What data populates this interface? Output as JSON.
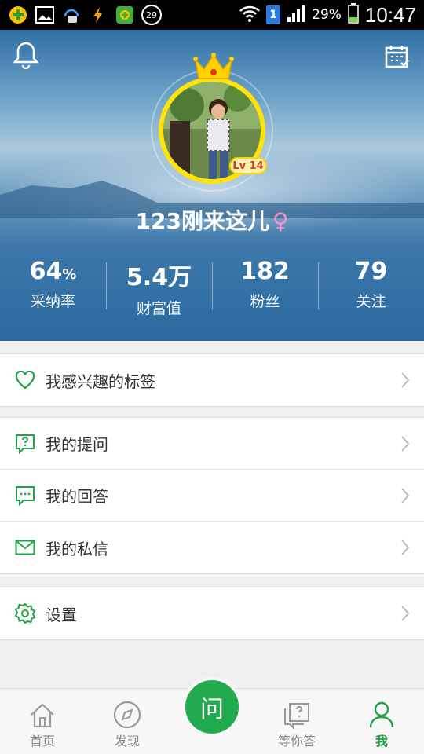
{
  "status_bar": {
    "badge_count": "29",
    "sim_slot": "1",
    "battery_percent": "29%",
    "time": "10:47"
  },
  "profile": {
    "level": "Lv 14",
    "username": "123刚来这儿",
    "gender_symbol": "♀"
  },
  "stats": [
    {
      "value": "64",
      "unit": "%",
      "label": "采纳率"
    },
    {
      "value": "5.4万",
      "unit": "",
      "label": "财富值"
    },
    {
      "value": "182",
      "unit": "",
      "label": "粉丝"
    },
    {
      "value": "79",
      "unit": "",
      "label": "关注"
    }
  ],
  "menu": {
    "interest_tags": "我感兴趣的标签",
    "my_questions": "我的提问",
    "my_answers": "我的回答",
    "my_messages": "我的私信",
    "settings": "设置"
  },
  "bottom_nav": {
    "home": "首页",
    "discover": "发现",
    "ask": "问",
    "waiting": "等你答",
    "me": "我"
  },
  "colors": {
    "accent": "#21a346",
    "crown": "#ffd200",
    "gender": "#ff8fd0"
  }
}
